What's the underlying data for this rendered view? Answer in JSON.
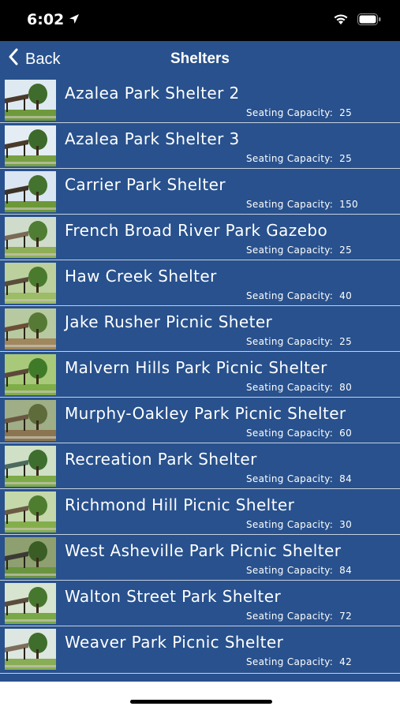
{
  "status": {
    "time": "6:02"
  },
  "nav": {
    "back_label": "Back",
    "title": "Shelters"
  },
  "capacity_label": "Seating Capacity:",
  "shelters": [
    {
      "name": "Azalea Park Shelter 2",
      "capacity": "25"
    },
    {
      "name": "Azalea Park Shelter 3",
      "capacity": "25"
    },
    {
      "name": "Carrier Park Shelter",
      "capacity": "150"
    },
    {
      "name": "French Broad River Park Gazebo",
      "capacity": "25"
    },
    {
      "name": "Haw Creek Shelter",
      "capacity": "40"
    },
    {
      "name": "Jake Rusher Picnic Sheter",
      "capacity": "25"
    },
    {
      "name": "Malvern Hills Park Picnic Shelter",
      "capacity": "80"
    },
    {
      "name": "Murphy-Oakley Park Picnic Shelter",
      "capacity": "60"
    },
    {
      "name": "Recreation Park Shelter",
      "capacity": "84"
    },
    {
      "name": "Richmond Hill Picnic Shelter",
      "capacity": "30"
    },
    {
      "name": "West Asheville Park Picnic Shelter",
      "capacity": "84"
    },
    {
      "name": "Walton Street Park Shelter",
      "capacity": "72"
    },
    {
      "name": "Weaver Park Picnic Shelter",
      "capacity": "42"
    }
  ],
  "colors": {
    "nav_background": "#28518d",
    "row_divider": "#c7d1e0",
    "text": "#ffffff"
  },
  "icons": {
    "back": "chevron-left-icon",
    "location": "location-arrow-icon",
    "wifi": "wifi-icon",
    "battery": "battery-icon"
  }
}
